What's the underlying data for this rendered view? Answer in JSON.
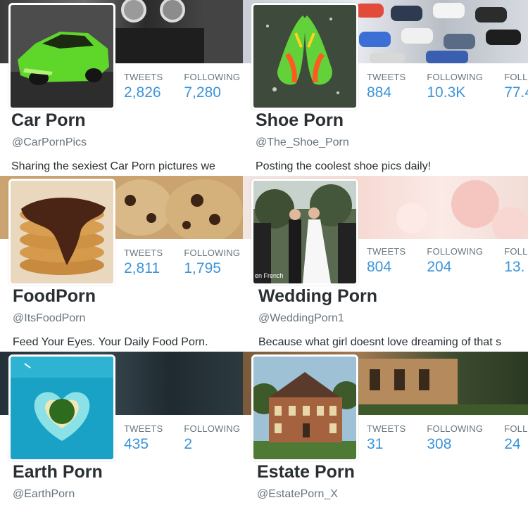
{
  "cards": [
    {
      "name": "Car Porn",
      "handle": "@CarPornPics",
      "bio": "Sharing the sexiest Car Porn pictures we",
      "stats": [
        {
          "label": "TWEETS",
          "value": "2,826"
        },
        {
          "label": "FOLLOWING",
          "value": "7,280"
        }
      ]
    },
    {
      "name": "Shoe Porn",
      "handle": "@The_Shoe_Porn",
      "bio": "Posting the coolest shoe pics daily!",
      "stats": [
        {
          "label": "TWEETS",
          "value": "884"
        },
        {
          "label": "FOLLOWING",
          "value": "10.3K"
        },
        {
          "label": "FOLLO",
          "value": "77.4"
        }
      ]
    },
    {
      "name": "FoodPorn",
      "handle": "@ItsFoodPorn",
      "bio": "Feed Your Eyes. Your Daily Food Porn.",
      "stats": [
        {
          "label": "TWEETS",
          "value": "2,811"
        },
        {
          "label": "FOLLOWING",
          "value": "1,795"
        }
      ]
    },
    {
      "name": "Wedding Porn",
      "handle": "@WeddingPorn1",
      "bio": "Because what girl doesnt love dreaming of that s",
      "stats": [
        {
          "label": "TWEETS",
          "value": "804"
        },
        {
          "label": "FOLLOWING",
          "value": "204"
        },
        {
          "label": "FOLL",
          "value": "13."
        }
      ]
    },
    {
      "name": "Earth Porn",
      "handle": "@EarthPorn",
      "bio": "",
      "stats": [
        {
          "label": "TWEETS",
          "value": "435"
        },
        {
          "label": "FOLLOWING",
          "value": "2"
        }
      ]
    },
    {
      "name": "Estate Porn",
      "handle": "@EstatePorn_X",
      "bio": "",
      "stats": [
        {
          "label": "TWEETS",
          "value": "31"
        },
        {
          "label": "FOLLOWING",
          "value": "308"
        },
        {
          "label": "FOLL",
          "value": "24"
        }
      ]
    }
  ],
  "avatar_text": "en French",
  "colors": {
    "stat_value": "#3b94d9",
    "stat_label": "#66757f",
    "name": "#292f33"
  }
}
